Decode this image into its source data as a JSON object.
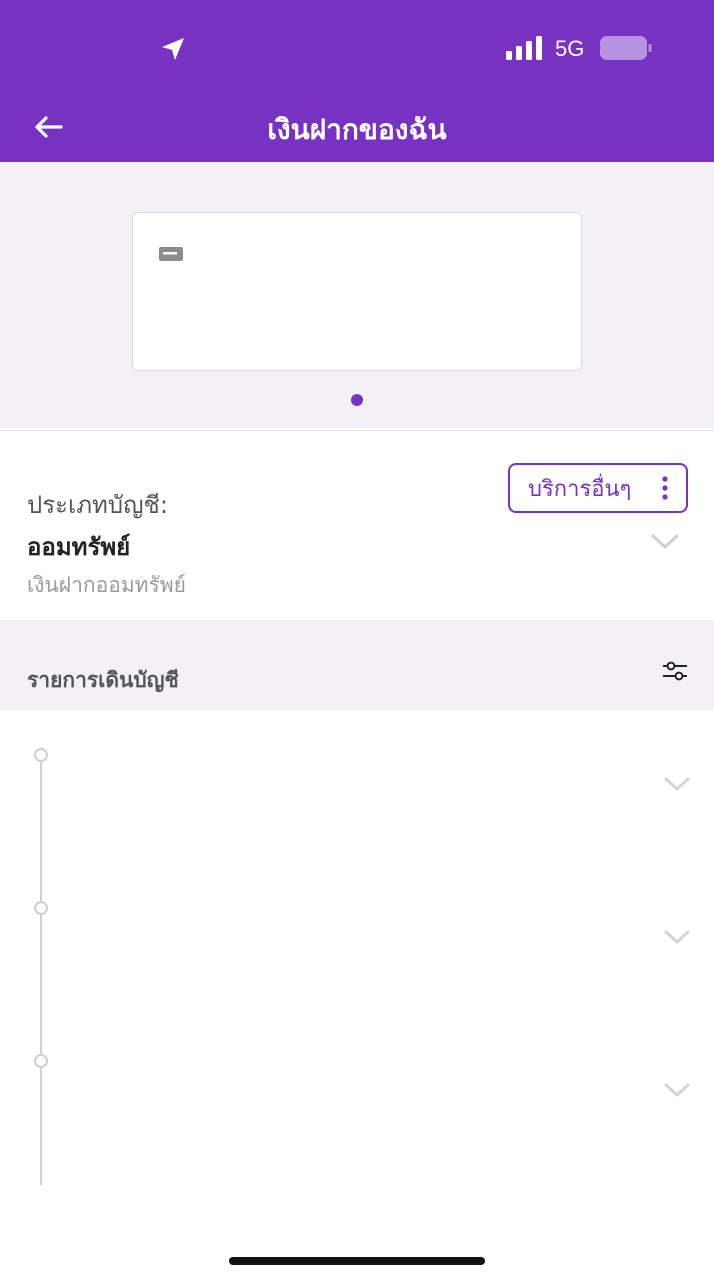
{
  "status_bar": {
    "network": "5G",
    "icons": [
      "location-arrow-icon",
      "signal-bars-icon",
      "battery-icon"
    ]
  },
  "header": {
    "title": "เงินฝากของฉัน",
    "back_icon": "arrow-left-icon"
  },
  "carousel": {
    "pages": 1,
    "active_page": 1,
    "card_icon": "bank-card-icon"
  },
  "account": {
    "type_label": "ประเภทบัญชี:",
    "type_value": "ออมทรัพย์",
    "type_sub": "เงินฝากออมทรัพย์",
    "more_services": "บริการอื่นๆ"
  },
  "transactions": {
    "title": "รายการเดินบัญชี",
    "filter_icon": "filter-sliders-icon",
    "rows": [
      {},
      {},
      {}
    ]
  },
  "colors": {
    "primary": "#7732c2",
    "background": "#f3f1f6"
  }
}
